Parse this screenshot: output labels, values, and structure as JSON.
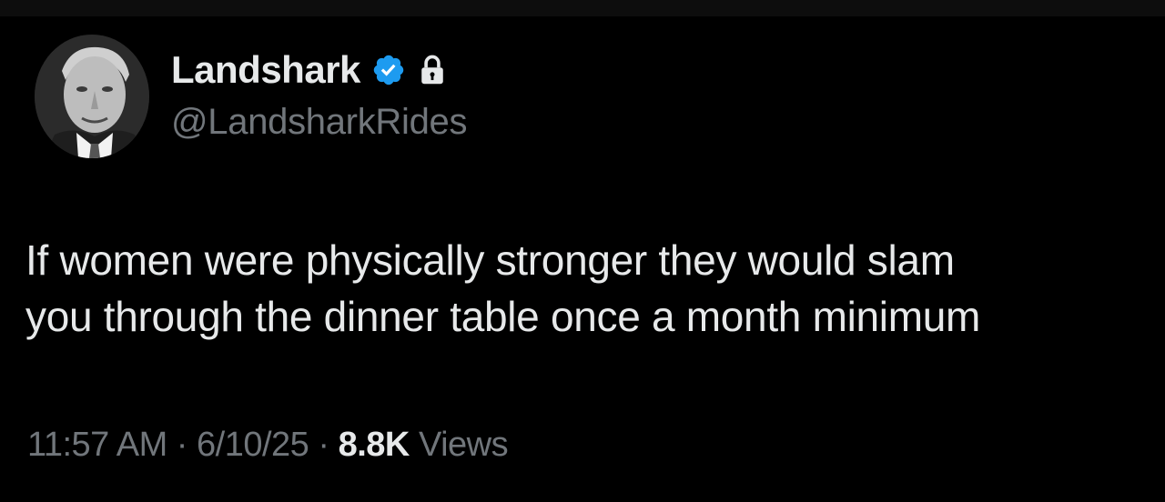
{
  "author": {
    "display_name": "Landshark",
    "handle": "@LandsharkRides",
    "avatar_icon": "person-portrait-icon",
    "verified_icon": "verified-badge-icon",
    "protected_icon": "lock-icon",
    "verified_color": "#1d9bf0"
  },
  "tweet": {
    "lines": [
      "If women were physically stronger they would slam",
      "you through the dinner table once a month minimum"
    ]
  },
  "meta": {
    "time": "11:57 AM",
    "separator": "·",
    "date": "6/10/25",
    "views_count": "8.8K",
    "views_label": "Views"
  },
  "colors": {
    "background": "#000000",
    "text_primary": "#e7e9ea",
    "text_secondary": "#71767b"
  }
}
